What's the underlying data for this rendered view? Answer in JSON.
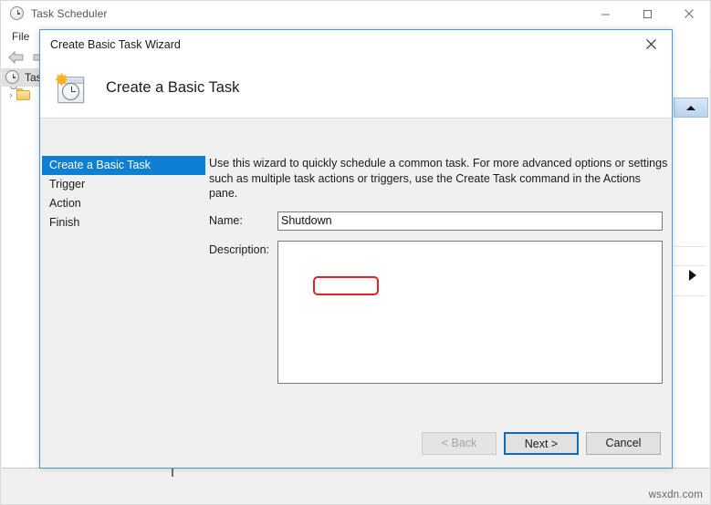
{
  "main_window": {
    "title": "Task Scheduler",
    "title_icon": "clock-icon",
    "menu": [
      {
        "label": "File"
      }
    ],
    "nav": {
      "back_icon": "back-arrow-icon",
      "forward_icon": "forward-arrow-icon"
    },
    "tree": [
      {
        "label": "Tas",
        "icon": "clock-icon",
        "selected": true,
        "chevron": ""
      },
      {
        "label": "",
        "icon": "folder-clock-icon",
        "selected": false,
        "chevron": "›"
      }
    ],
    "window_controls": {
      "minimize": "minimize-icon",
      "maximize": "maximize-icon",
      "close": "close-icon"
    },
    "actions_pane": {
      "scroll_up": "scroll-up-arrow",
      "expand": "expand-right-arrow"
    }
  },
  "dialog": {
    "titlebar": {
      "title": "Create Basic Task Wizard",
      "close_label": "✕"
    },
    "header": {
      "heading": "Create a Basic Task",
      "icon": "task-wizard-icon",
      "star_glyph": "✸"
    },
    "steps": [
      {
        "label": "Create a Basic Task",
        "active": true
      },
      {
        "label": "Trigger",
        "active": false
      },
      {
        "label": "Action",
        "active": false
      },
      {
        "label": "Finish",
        "active": false
      }
    ],
    "intro_text": "Use this wizard to quickly schedule a common task.  For more advanced options or settings such as multiple task actions or triggers, use the Create Task command in the Actions pane.",
    "fields": {
      "name_label": "Name:",
      "name_value": "Shutdown",
      "name_placeholder": "",
      "description_label": "Description:",
      "description_value": "",
      "description_placeholder": ""
    },
    "annotation": {
      "type": "red-highlight-box",
      "color": "#e8202a",
      "target": "name-input-value"
    },
    "buttons": {
      "back": "< Back",
      "next": "Next >",
      "cancel": "Cancel"
    }
  },
  "watermark": {
    "text": "wsxdn.com"
  },
  "colors": {
    "selection_blue": "#0f7fd4",
    "default_button_border": "#0f6cbd",
    "dialog_border": "#4a9ad4",
    "annotation_red": "#e8202a",
    "window_bg": "#f0f0f0"
  }
}
